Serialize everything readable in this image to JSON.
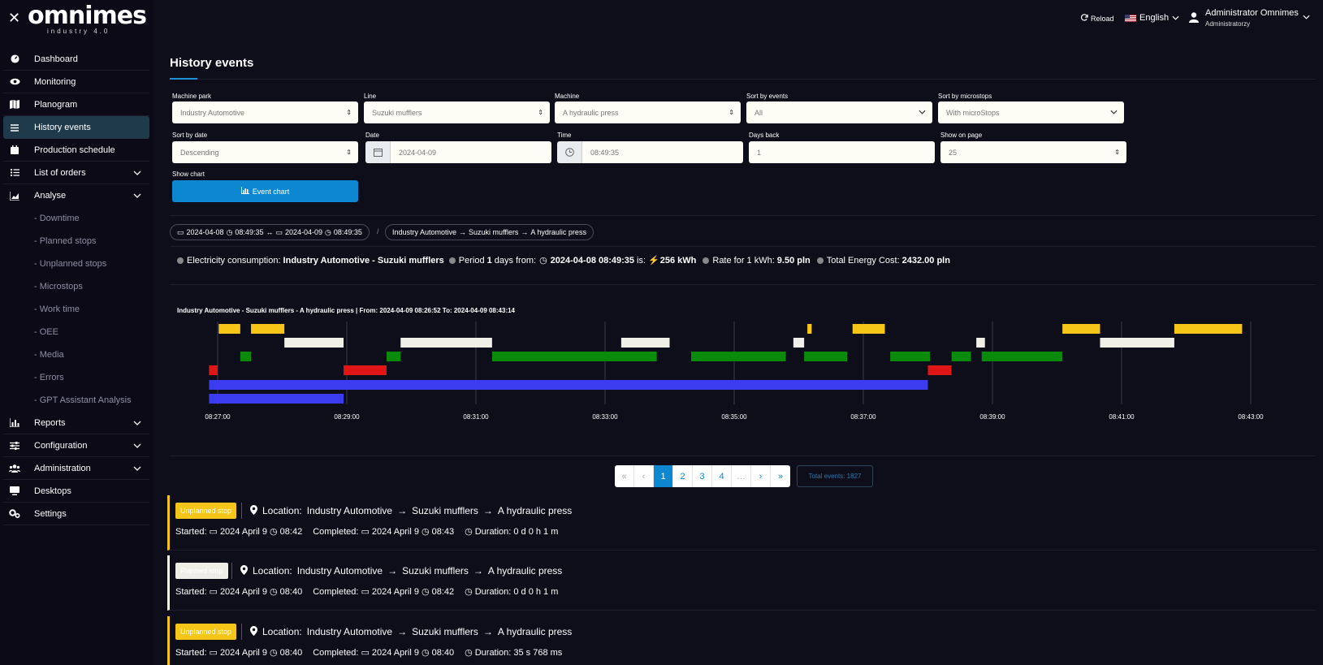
{
  "sidebar": {
    "logo": "omnimes",
    "logo_sub": "industry 4.0",
    "items": [
      {
        "label": "Dashboard"
      },
      {
        "label": "Monitoring"
      },
      {
        "label": "Planogram"
      },
      {
        "label": "History events"
      },
      {
        "label": "Production schedule"
      },
      {
        "label": "List of orders"
      },
      {
        "label": "Analyse"
      }
    ],
    "analyse_sub": [
      "- Downtime",
      "- Planned stops",
      "- Unplanned stops",
      "- Microstops",
      "- Work time",
      "- OEE",
      "- Media",
      "- Errors",
      "- GPT Assistant Analysis"
    ],
    "bottom_items": [
      {
        "label": "Reports"
      },
      {
        "label": "Configuration"
      },
      {
        "label": "Administration"
      },
      {
        "label": "Desktops"
      },
      {
        "label": "Settings"
      }
    ]
  },
  "topbar": {
    "reload": "Reload",
    "language": "English",
    "user_name": "Administrator Omnimes",
    "user_role": "Administratorzy"
  },
  "page": {
    "title": "History events"
  },
  "filters": {
    "machine_park": {
      "label": "Machine park",
      "value": "Industry Automotive"
    },
    "line": {
      "label": "Line",
      "value": "Suzuki mufflers"
    },
    "machine": {
      "label": "Machine",
      "value": "A hydraulic press"
    },
    "sort_events": {
      "label": "Sort by events",
      "value": "All"
    },
    "sort_microstops": {
      "label": "Sort by microstops",
      "value": "With microStops"
    },
    "sort_date": {
      "label": "Sort by date",
      "value": "Descending"
    },
    "date": {
      "label": "Date",
      "value": "2024-04-09"
    },
    "time": {
      "label": "Time",
      "value": "08:49:35"
    },
    "days_back": {
      "label": "Days back",
      "value": "1"
    },
    "show_on_page": {
      "label": "Show on page",
      "value": "25"
    },
    "show_chart": {
      "label": "Show chart"
    },
    "event_chart_button": "Event chart"
  },
  "range": {
    "from_date": "2024-04-08",
    "from_time": "08:49:35",
    "to_date": "2024-04-09",
    "to_time": "08:49:35",
    "path": [
      "Industry Automotive",
      "Suzuki mufflers",
      "A hydraulic press"
    ]
  },
  "energy": {
    "prefix": "Electricity consumption:",
    "location": "Industry Automotive - Suzuki mufflers",
    "period_a": "Period",
    "period_days": "1",
    "period_b": "days from:",
    "from": "2024-04-08 08:49:35",
    "is": "is:",
    "kwh": "256 kWh",
    "rate_label": "Rate for 1 kWh:",
    "rate": "9.50 pln",
    "cost_label": "Total Energy Cost:",
    "cost": "2432.00 pln"
  },
  "chart_data": {
    "type": "timeline",
    "title": "Industry Automotive - Suzuki mufflers - A hydraulic press | From: 2024-04-09 08:26:52 To: 2024-04-09 08:43:14",
    "x_ticks": [
      "08:27:00",
      "08:29:00",
      "08:31:00",
      "08:33:00",
      "08:35:00",
      "08:37:00",
      "08:39:00",
      "08:41:00",
      "08:43:00"
    ],
    "colors": {
      "unplanned": "#f5c518",
      "planned": "#f0f0e8",
      "work": "#0a8a0a",
      "error": "#e01515",
      "blue": "#3b3bf0"
    },
    "rows": [
      {
        "color": "unplanned",
        "segments": [
          [
            "08:27:01",
            "08:27:21"
          ],
          [
            "08:27:31",
            "08:28:02"
          ],
          [
            "08:36:08",
            "08:36:12"
          ],
          [
            "08:36:50",
            "08:37:20"
          ],
          [
            "08:40:05",
            "08:40:40"
          ],
          [
            "08:41:49",
            "08:42:52"
          ]
        ]
      },
      {
        "color": "planned",
        "segments": [
          [
            "08:28:02",
            "08:28:57"
          ],
          [
            "08:29:50",
            "08:31:15"
          ],
          [
            "08:33:15",
            "08:34:00"
          ],
          [
            "08:35:55",
            "08:36:05"
          ],
          [
            "08:38:45",
            "08:38:53"
          ],
          [
            "08:40:40",
            "08:41:49"
          ]
        ]
      },
      {
        "color": "work",
        "segments": [
          [
            "08:27:21",
            "08:27:31"
          ],
          [
            "08:29:37",
            "08:29:50"
          ],
          [
            "08:31:15",
            "08:33:48"
          ],
          [
            "08:34:20",
            "08:35:48"
          ],
          [
            "08:36:05",
            "08:36:45"
          ],
          [
            "08:37:25",
            "08:38:02"
          ],
          [
            "08:38:22",
            "08:38:40"
          ],
          [
            "08:38:50",
            "08:40:05"
          ]
        ]
      },
      {
        "color": "error",
        "segments": [
          [
            "08:26:52",
            "08:27:00"
          ],
          [
            "08:28:57",
            "08:29:37"
          ],
          [
            "08:38:00",
            "08:38:22"
          ]
        ]
      },
      {
        "color": "blue",
        "segments": [
          [
            "08:26:52",
            "08:38:00"
          ]
        ]
      },
      {
        "color": "blue",
        "segments": [
          [
            "08:26:52",
            "08:28:57"
          ]
        ]
      }
    ]
  },
  "pagination": {
    "first": "«",
    "prev": "‹",
    "pages": [
      "1",
      "2",
      "3",
      "4"
    ],
    "ellipsis": "…",
    "next": "›",
    "last": "»",
    "active": "1",
    "total": "Total events: 1827"
  },
  "events": [
    {
      "type": "Unplanned stop",
      "kind": "unplanned",
      "location_label": "Location:",
      "path": [
        "Industry Automotive",
        "Suzuki mufflers",
        "A hydraulic press"
      ],
      "started_label": "Started:",
      "start_date": "2024 April 9",
      "start_time": "08:42",
      "completed_label": "Completed:",
      "end_date": "2024 April 9",
      "end_time": "08:43",
      "duration_label": "Duration:",
      "duration": "0 d 0 h 1 m"
    },
    {
      "type": "Planned stop",
      "kind": "planned",
      "location_label": "Location:",
      "path": [
        "Industry Automotive",
        "Suzuki mufflers",
        "A hydraulic press"
      ],
      "started_label": "Started:",
      "start_date": "2024 April 9",
      "start_time": "08:40",
      "completed_label": "Completed:",
      "end_date": "2024 April 9",
      "end_time": "08:42",
      "duration_label": "Duration:",
      "duration": "0 d 0 h 1 m"
    },
    {
      "type": "Unplanned stop",
      "kind": "unplanned",
      "location_label": "Location:",
      "path": [
        "Industry Automotive",
        "Suzuki mufflers",
        "A hydraulic press"
      ],
      "started_label": "Started:",
      "start_date": "2024 April 9",
      "start_time": "08:40",
      "completed_label": "Completed:",
      "end_date": "2024 April 9",
      "end_time": "08:40",
      "duration_label": "Duration:",
      "duration": "35 s 768 ms"
    }
  ]
}
